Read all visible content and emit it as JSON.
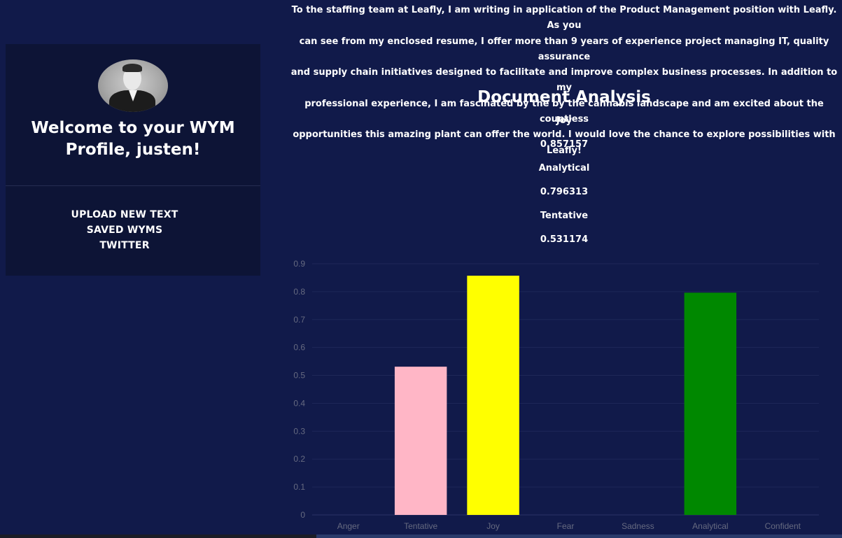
{
  "sidebar": {
    "welcome_line1": "Welcome to your WYM",
    "welcome_line2": "Profile, justen!",
    "nav": [
      {
        "label": "UPLOAD NEW TEXT"
      },
      {
        "label": "SAVED WYMS"
      },
      {
        "label": "TWITTER"
      }
    ]
  },
  "letter": {
    "lines": [
      "To the staffing team at Leafly, I am writing in application of the Product Management position with Leafly. As you",
      "can see from my enclosed resume, I offer more than 9 years of experience project managing IT, quality assurance",
      "and supply chain initiatives designed to facilitate and improve complex business processes. In addition to my",
      "professional experience, I am fascinated by the by the cannabis landscape and am excited about the countless",
      "opportunities this amazing plant can offer the world. I would love the chance to explore possibilities with Leafly!"
    ]
  },
  "analysis": {
    "title": "Document Analysis",
    "tones": [
      {
        "name": "Joy",
        "score": "0.857157"
      },
      {
        "name": "Analytical",
        "score": "0.796313"
      },
      {
        "name": "Tentative",
        "score": "0.531174"
      }
    ]
  },
  "colors": {
    "background": "#111a4a",
    "panel": "#0d1436",
    "tentative": "#ffb6c6",
    "joy": "#ffff00",
    "analytical": "#008800"
  },
  "chart_data": {
    "type": "bar",
    "categories": [
      "Anger",
      "Tentative",
      "Joy",
      "Fear",
      "Sadness",
      "Analytical",
      "Confident"
    ],
    "values": [
      0,
      0.531174,
      0.857157,
      0,
      0,
      0.796313,
      0
    ],
    "colors": [
      "#ff0000",
      "#ffb6c6",
      "#ffff00",
      "#800080",
      "#0000ff",
      "#008800",
      "#ffa500"
    ],
    "ylim": [
      0,
      0.9
    ],
    "yticks": [
      "0.9",
      "0.8",
      "0.7",
      "0.6",
      "0.5",
      "0.4",
      "0.3",
      "0.2",
      "0.1",
      "0"
    ],
    "grid": true
  }
}
